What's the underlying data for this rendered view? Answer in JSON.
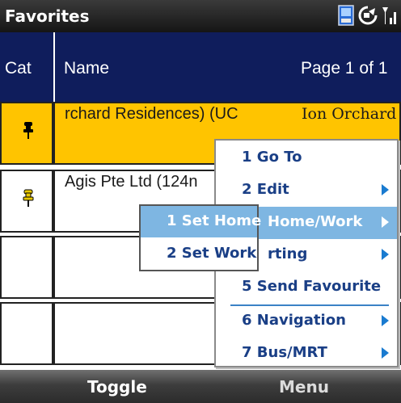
{
  "titlebar": {
    "title": "Favorites",
    "icons": [
      "device-icon",
      "connection-icon",
      "signal-icon"
    ]
  },
  "header": {
    "cat_label": "Cat",
    "name_label": "Name",
    "page_label": "Page 1 of 1"
  },
  "rows": [
    {
      "name": "rchard Residences) (UC",
      "address": "Ion Orchard",
      "icon": "pushpin-icon",
      "selected": true
    },
    {
      "name": "Agis Pte Ltd (124n",
      "address": "",
      "icon": "pushpin-icon",
      "selected": false
    },
    {
      "name": "",
      "address": "",
      "icon": "",
      "selected": false
    },
    {
      "name": "",
      "address": "",
      "icon": "",
      "selected": false
    }
  ],
  "menu": {
    "items": [
      {
        "label": "1 Go To",
        "has_submenu": false,
        "highlighted": false
      },
      {
        "label": "2 Edit",
        "has_submenu": true,
        "highlighted": false
      },
      {
        "label": "Home/Work",
        "has_submenu": true,
        "highlighted": true
      },
      {
        "label": "rting",
        "has_submenu": true,
        "highlighted": false
      },
      {
        "label": "5 Send Favourite",
        "has_submenu": false,
        "highlighted": false
      },
      {
        "label": "6 Navigation",
        "has_submenu": true,
        "highlighted": false
      },
      {
        "label": "7 Bus/MRT",
        "has_submenu": true,
        "highlighted": false
      }
    ]
  },
  "submenu": {
    "items": [
      {
        "label": "1 Set Home",
        "highlighted": true
      },
      {
        "label": "2 Set Work",
        "highlighted": false
      }
    ]
  },
  "softkeys": {
    "left": "Toggle",
    "right": "Menu"
  },
  "colors": {
    "header_bg": "#0f1d5c",
    "selected_row": "#ffc400",
    "menu_highlight": "#7eb6e2",
    "menu_text": "#1a3f86"
  }
}
